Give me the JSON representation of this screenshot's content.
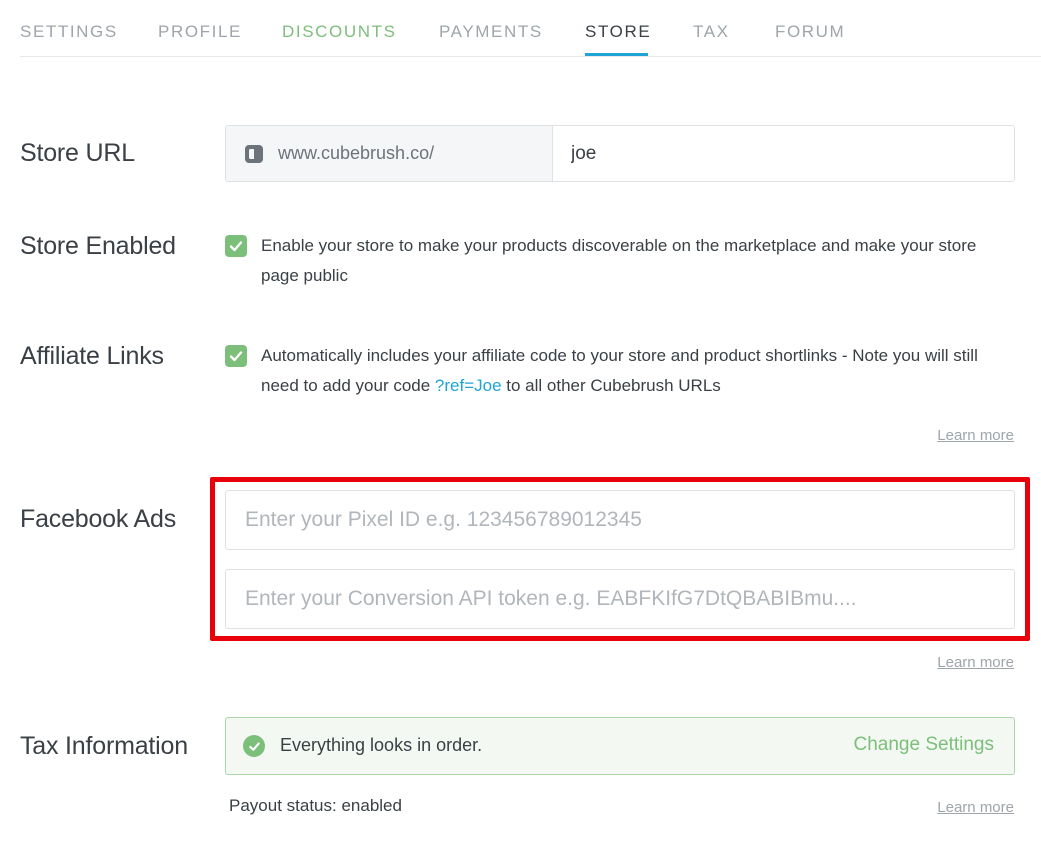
{
  "tabs": [
    {
      "label": "SETTINGS"
    },
    {
      "label": "PROFILE"
    },
    {
      "label": "DISCOUNTS"
    },
    {
      "label": "PAYMENTS"
    },
    {
      "label": "STORE"
    },
    {
      "label": "TAX"
    },
    {
      "label": "FORUM"
    }
  ],
  "active_tab": "STORE",
  "store_url": {
    "label": "Store URL",
    "prefix": "www.cubebrush.co/",
    "value": "joe",
    "prefix_icon": "cubebrush-logo-icon"
  },
  "store_enabled": {
    "label": "Store Enabled",
    "checked": true,
    "description": "Enable your store to make your products discoverable on the marketplace and make your store page public"
  },
  "affiliate_links": {
    "label": "Affiliate Links",
    "checked": true,
    "description_before": "Automatically includes your affiliate code to your store and product shortlinks - Note you will still need to add your code ",
    "code_link": "?ref=Joe",
    "description_after": " to all other Cubebrush URLs",
    "learn_more": "Learn more"
  },
  "facebook_ads": {
    "label": "Facebook Ads",
    "pixel_placeholder": "Enter your Pixel ID e.g. 123456789012345",
    "token_placeholder": "Enter your Conversion API token e.g. EABFKIfG7DtQBABIBmu....",
    "learn_more": "Learn more",
    "highlight_color": "#e8000a"
  },
  "tax_information": {
    "label": "Tax Information",
    "status_text": "Everything looks in order.",
    "change_settings": "Change Settings",
    "payout_status": "Payout status: enabled",
    "learn_more": "Learn more"
  },
  "colors": {
    "accent_blue": "#1fa4d8",
    "accent_green": "#7cbf7a",
    "text": "#3a4046",
    "muted": "#9ea5ab"
  }
}
